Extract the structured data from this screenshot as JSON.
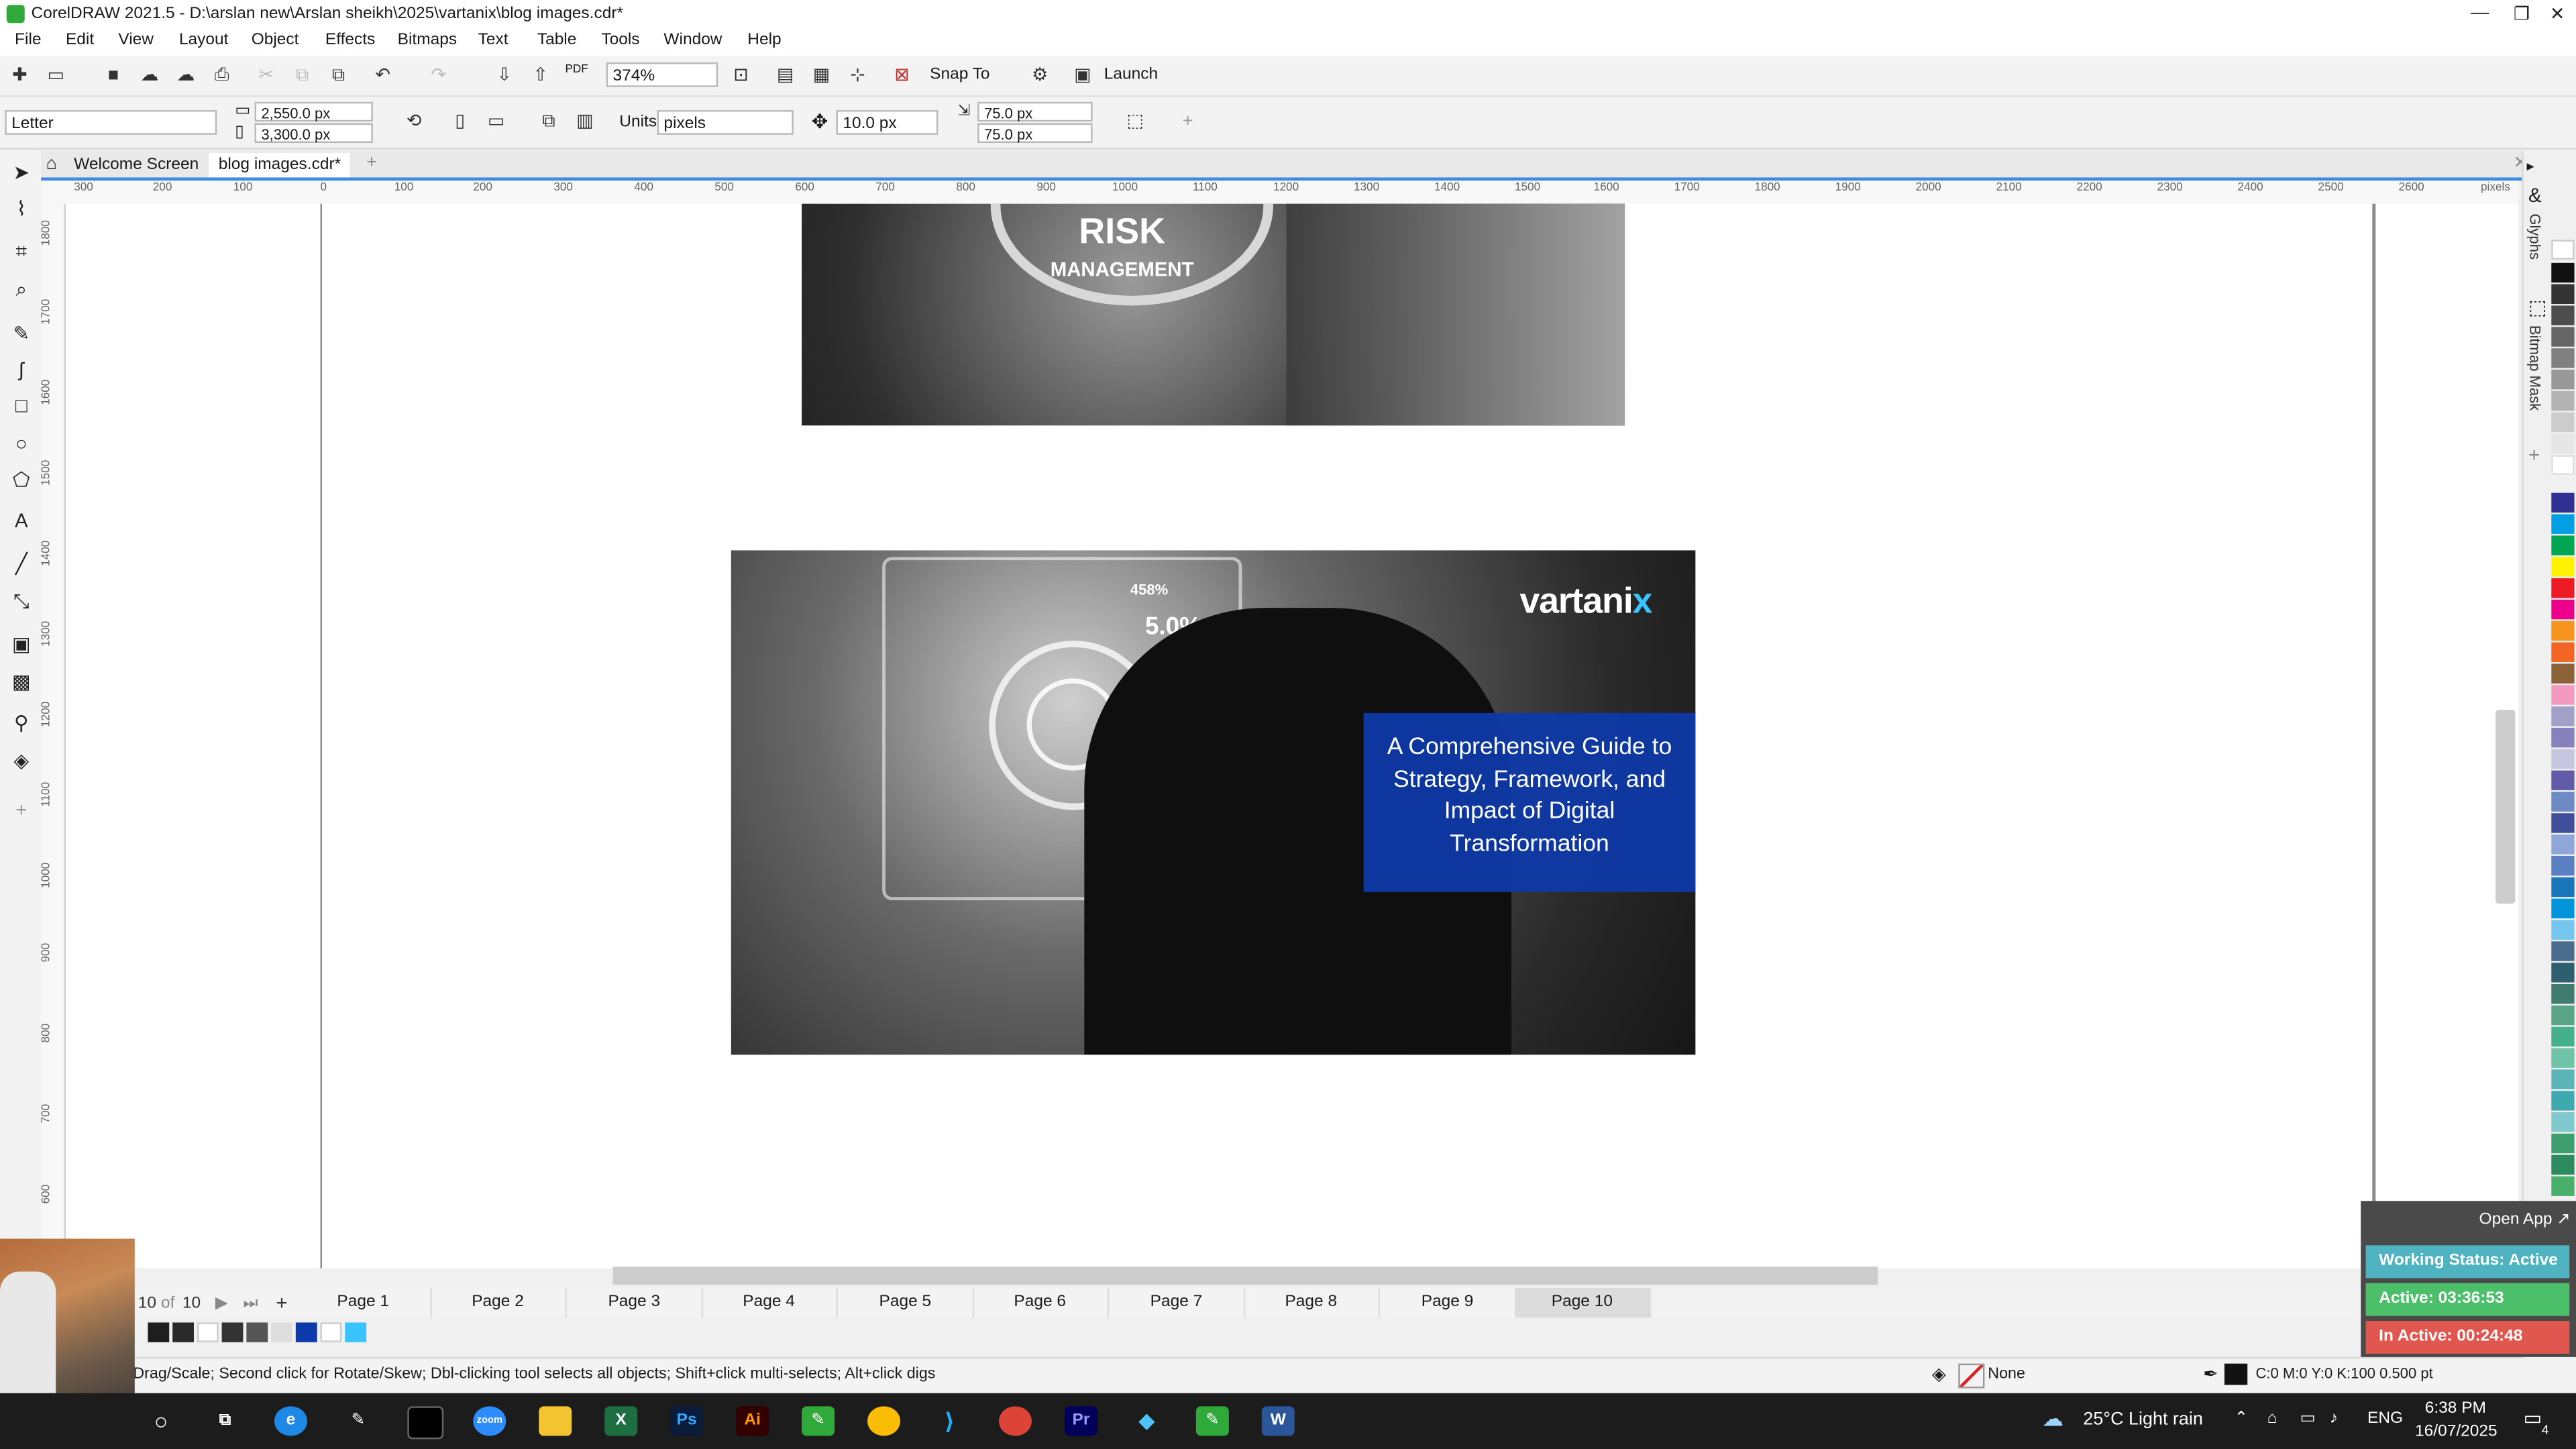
{
  "window": {
    "title": "CorelDRAW 2021.5 - D:\\arslan new\\Arslan sheikh\\2025\\vartanix\\blog images.cdr*"
  },
  "menu": [
    "File",
    "Edit",
    "View",
    "Layout",
    "Object",
    "Effects",
    "Bitmaps",
    "Text",
    "Table",
    "Tools",
    "Window",
    "Help"
  ],
  "standard_toolbar": {
    "zoom": "374%",
    "snap_label": "Snap To",
    "launch_label": "Launch",
    "pdf_label": "PDF"
  },
  "property_bar": {
    "page_size": "Letter",
    "width": "2,550.0 px",
    "height": "3,300.0 px",
    "units_label": "Units:",
    "units_value": "pixels",
    "nudge": "10.0 px",
    "dup_x": "75.0 px",
    "dup_y": "75.0 px"
  },
  "doc_tabs": [
    "Welcome Screen",
    "blog images.cdr*"
  ],
  "ruler": {
    "h": [
      "300",
      "200",
      "100",
      "0",
      "100",
      "200",
      "300",
      "400",
      "500",
      "600",
      "700",
      "800",
      "900",
      "1000",
      "1100",
      "1200",
      "1300",
      "1400",
      "1500",
      "1600",
      "1700",
      "1800",
      "1900",
      "2000",
      "2100",
      "2200",
      "2300",
      "2400",
      "2500",
      "2600",
      "pixels"
    ],
    "v": [
      "1800",
      "1700",
      "1600",
      "1500",
      "1400",
      "1300",
      "1200",
      "1100",
      "1000",
      "900",
      "800",
      "700",
      "600"
    ]
  },
  "canvas": {
    "image1": {
      "line1": "RISK",
      "line2": "MANAGEMENT"
    },
    "image2": {
      "brand": "vartani",
      "brand_x": "x",
      "hud1": "458%",
      "hud2": "5.0%",
      "headline": "A Comprehensive Guide to Strategy, Framework, and Impact of Digital Transformation"
    }
  },
  "page_nav": {
    "current": "10",
    "of": "of",
    "total": "10",
    "pages": [
      "Page 1",
      "Page 2",
      "Page 3",
      "Page 4",
      "Page 5",
      "Page 6",
      "Page 7",
      "Page 8",
      "Page 9",
      "Page 10"
    ]
  },
  "status": {
    "hint": "Drag/Scale; Second click for Rotate/Skew; Dbl-clicking tool selects all objects; Shift+click multi-selects; Alt+click digs",
    "fill": "None",
    "outline": "C:0 M:0 Y:0 K:100  0.500 pt"
  },
  "dock_labels": [
    "Glyphs",
    "Bitmap Mask"
  ],
  "tracker": {
    "open": "Open App ↗",
    "working": "Working Status: Active",
    "active": "Active: 03:36:53",
    "inactive": "In Active: 00:24:48"
  },
  "taskbar": {
    "weather": "25°C  Light rain",
    "lang": "ENG",
    "time": "6:38 PM",
    "date": "16/07/2025",
    "notif": "4"
  },
  "colors": {
    "accent": "#3c8be6",
    "headline_box": "#0d3aaa",
    "tracker_working": "#4fb3c1",
    "tracker_active": "#4cbf6a",
    "tracker_inactive": "#e0574f"
  }
}
